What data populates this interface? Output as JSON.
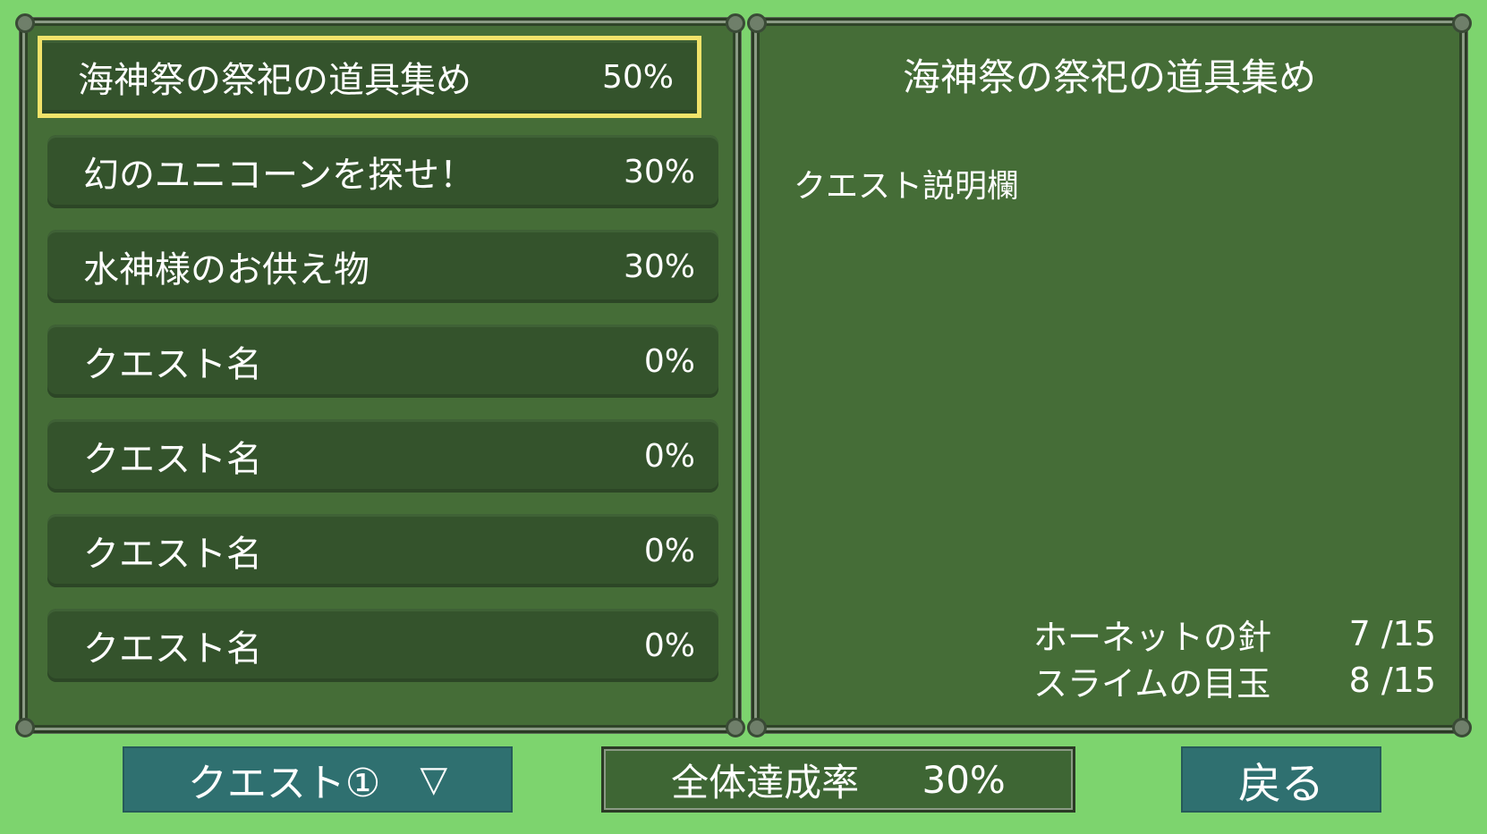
{
  "quests": [
    {
      "name": "海神祭の祭祀の道具集め",
      "percent": "50%",
      "selected": true
    },
    {
      "name": "幻のユニコーンを探せ！",
      "percent": "30%",
      "selected": false
    },
    {
      "name": "水神様のお供え物",
      "percent": "30%",
      "selected": false
    },
    {
      "name": "クエスト名",
      "percent": "0%",
      "selected": false
    },
    {
      "name": "クエスト名",
      "percent": "0%",
      "selected": false
    },
    {
      "name": "クエスト名",
      "percent": "0%",
      "selected": false
    },
    {
      "name": "クエスト名",
      "percent": "0%",
      "selected": false
    }
  ],
  "detail": {
    "title": "海神祭の祭祀の道具集め",
    "description": "クエスト説明欄",
    "requirements": [
      {
        "item": "ホーネットの針",
        "count": "7 /15"
      },
      {
        "item": "スライムの目玉",
        "count": "8 /15"
      }
    ]
  },
  "footer": {
    "quest_select_label": "クエスト①",
    "quest_select_arrow": "▽",
    "overall_label": "全体達成率",
    "overall_value": "30%",
    "back_label": "戻る"
  }
}
